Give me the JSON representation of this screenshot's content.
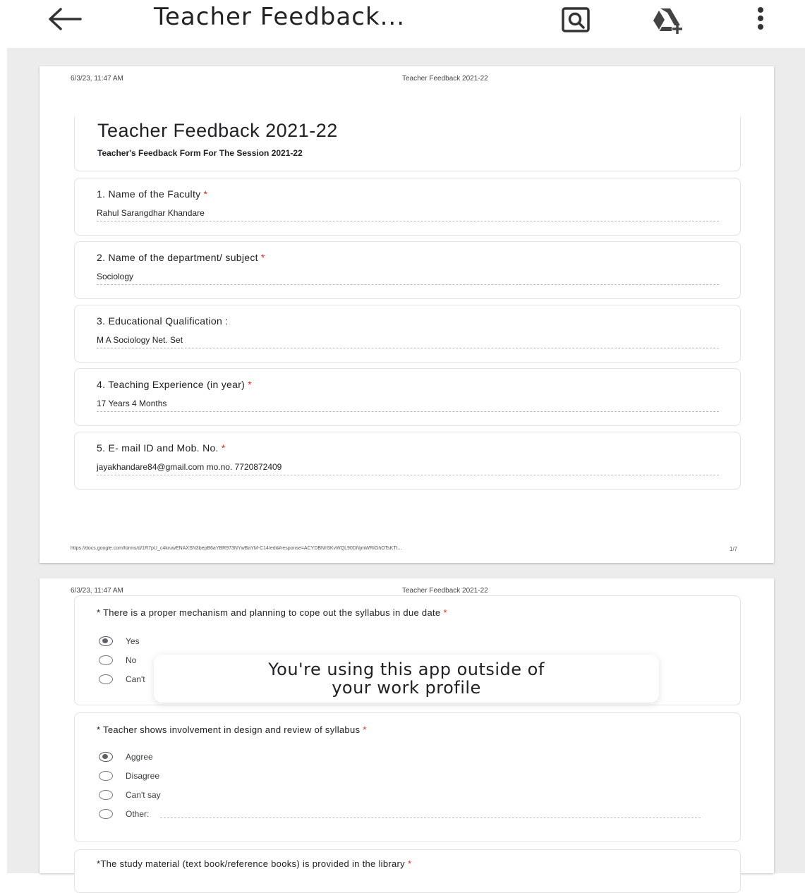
{
  "appbar": {
    "title": "Teacher Feedback..."
  },
  "page1": {
    "timestamp": "6/3/23, 11:47 AM",
    "header_title": "Teacher Feedback 2021-22",
    "form_title": "Teacher Feedback 2021-22",
    "form_description": "Teacher's Feedback Form For The Session 2021-22",
    "questions": [
      {
        "label": "1. Name of the Faculty",
        "required": "*",
        "answer": "Rahul Sarangdhar Khandare"
      },
      {
        "label": "2. Name of the department/ subject",
        "required": "*",
        "answer": "Sociology"
      },
      {
        "label": "3. Educational Qualification :",
        "required": "",
        "answer": "M A Sociology Net. Set"
      },
      {
        "label": "4. Teaching Experience (in year)",
        "required": "*",
        "answer": "17 Years 4 Months"
      },
      {
        "label": "5. E- mail ID and Mob. No.",
        "required": "*",
        "answer": "jayakhandare84@gmail.com  mo.no. 7720872409"
      }
    ],
    "url": "https://docs.google.com/forms/d/1R7pU_c4kruwENAXSN3bepB6aYBR973NYwBaYM-C14/edit#response=ACYDBNh5KvWQL90DNjmWRIGhOTsKTt...",
    "page_number": "1/7"
  },
  "page2": {
    "timestamp": "6/3/23, 11:47 AM",
    "header_title": "Teacher Feedback 2021-22",
    "q6": {
      "label": "* There is a proper mechanism and planning to cope out the syllabus in due date",
      "required": "*",
      "options": [
        "Yes",
        "No",
        "Can't"
      ],
      "selected": "Yes"
    },
    "q7": {
      "label": "* Teacher shows involvement in design and review of syllabus",
      "required": "*",
      "options": [
        "Aggree",
        "Disagree",
        "Can't say",
        "Other:"
      ],
      "selected": "Aggree"
    },
    "q8": {
      "label": "*The  study material (text book/reference books) is provided in the library",
      "required": "*"
    }
  },
  "toast": {
    "line1": "You're using this app outside of",
    "line2": "your work profile"
  },
  "icons": {
    "back": "arrow-left-icon",
    "search": "search-document-icon",
    "drive": "add-to-drive-icon",
    "more": "more-vert-icon"
  }
}
